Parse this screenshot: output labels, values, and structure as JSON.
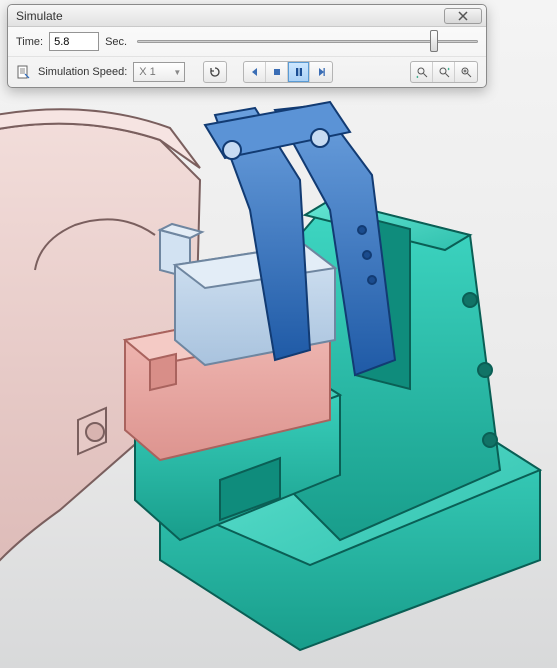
{
  "window": {
    "title": "Simulate",
    "close_aria": "Close"
  },
  "row1": {
    "time_label": "Time:",
    "time_value": "5.8",
    "unit_label": "Sec."
  },
  "row2": {
    "doc_icon": "options-properties-icon",
    "speed_label": "Simulation Speed:",
    "speed_value": "X 1",
    "refresh_icon": "refresh-icon",
    "prev_icon": "step-back-icon",
    "stop_icon": "stop-icon",
    "pause_icon": "pause-icon",
    "next_icon": "step-forward-icon",
    "zoom_in_icon": "zoom-previous-icon",
    "zoom_out_icon": "zoom-next-icon",
    "fit_icon": "zoom-fit-icon"
  },
  "cad": {
    "desc": "3D CAD assembly view: pink housing part (left), teal fixture block (right), blue twin-lever clamp mechanism on top, light-blue and salmon inner blocks clamped between them.",
    "colors": {
      "housing": "#e9cfce",
      "housing_edge": "#7a5f5e",
      "fixture": "#24c0ad",
      "fixture_edge": "#0a5f55",
      "clamp": "#2f74c5",
      "clamp_light": "#5b93d6",
      "insert_blue": "#b9cfe6",
      "insert_red": "#e8a6a2"
    }
  }
}
